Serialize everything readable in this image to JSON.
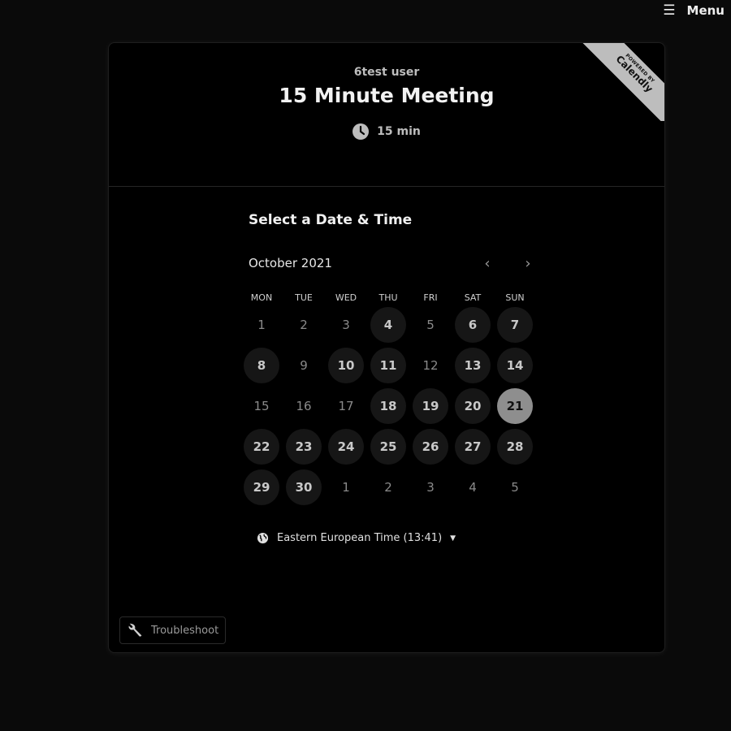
{
  "topbar": {
    "menu_label": "Menu"
  },
  "branding": {
    "powered_by": "POWERED BY",
    "brand": "Calendly"
  },
  "event": {
    "owner": "6test user",
    "title": "15 Minute Meeting",
    "duration": "15 min"
  },
  "scheduler": {
    "heading": "Select a Date & Time",
    "month_label": "October 2021",
    "weekdays": [
      "MON",
      "TUE",
      "WED",
      "THU",
      "FRI",
      "SAT",
      "SUN"
    ],
    "days": [
      {
        "label": "1",
        "state": "unavailable"
      },
      {
        "label": "2",
        "state": "unavailable"
      },
      {
        "label": "3",
        "state": "unavailable"
      },
      {
        "label": "4",
        "state": "available"
      },
      {
        "label": "5",
        "state": "unavailable"
      },
      {
        "label": "6",
        "state": "available"
      },
      {
        "label": "7",
        "state": "available"
      },
      {
        "label": "8",
        "state": "available"
      },
      {
        "label": "9",
        "state": "unavailable"
      },
      {
        "label": "10",
        "state": "available"
      },
      {
        "label": "11",
        "state": "available"
      },
      {
        "label": "12",
        "state": "unavailable"
      },
      {
        "label": "13",
        "state": "available"
      },
      {
        "label": "14",
        "state": "available"
      },
      {
        "label": "15",
        "state": "unavailable"
      },
      {
        "label": "16",
        "state": "unavailable"
      },
      {
        "label": "17",
        "state": "unavailable"
      },
      {
        "label": "18",
        "state": "available"
      },
      {
        "label": "19",
        "state": "available"
      },
      {
        "label": "20",
        "state": "available"
      },
      {
        "label": "21",
        "state": "selected"
      },
      {
        "label": "22",
        "state": "available"
      },
      {
        "label": "23",
        "state": "available"
      },
      {
        "label": "24",
        "state": "available"
      },
      {
        "label": "25",
        "state": "available"
      },
      {
        "label": "26",
        "state": "available"
      },
      {
        "label": "27",
        "state": "available"
      },
      {
        "label": "28",
        "state": "available"
      },
      {
        "label": "29",
        "state": "available"
      },
      {
        "label": "30",
        "state": "available"
      },
      {
        "label": "1",
        "state": "unavailable"
      },
      {
        "label": "2",
        "state": "unavailable"
      },
      {
        "label": "3",
        "state": "unavailable"
      },
      {
        "label": "4",
        "state": "unavailable"
      },
      {
        "label": "5",
        "state": "unavailable"
      }
    ],
    "timezone": "Eastern European Time (13:41)"
  },
  "footer": {
    "troubleshoot_label": "Troubleshoot"
  },
  "colors": {
    "background": "#000000",
    "selected_day": "#8e8e8e",
    "available_day": "#161616",
    "ribbon": "#bdbdbd"
  }
}
